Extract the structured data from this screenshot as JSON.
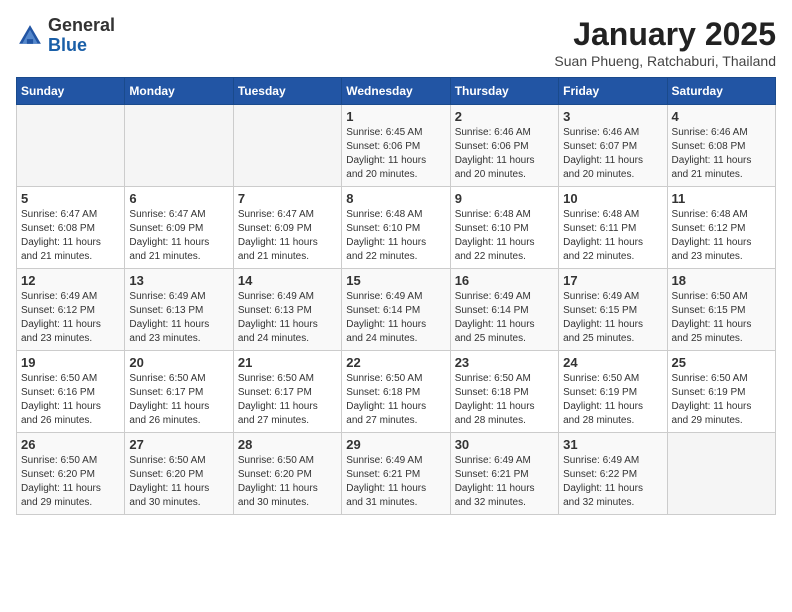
{
  "header": {
    "logo_general": "General",
    "logo_blue": "Blue",
    "month_title": "January 2025",
    "subtitle": "Suan Phueng, Ratchaburi, Thailand"
  },
  "weekdays": [
    "Sunday",
    "Monday",
    "Tuesday",
    "Wednesday",
    "Thursday",
    "Friday",
    "Saturday"
  ],
  "weeks": [
    [
      {
        "day": "",
        "info": ""
      },
      {
        "day": "",
        "info": ""
      },
      {
        "day": "",
        "info": ""
      },
      {
        "day": "1",
        "info": "Sunrise: 6:45 AM\nSunset: 6:06 PM\nDaylight: 11 hours\nand 20 minutes."
      },
      {
        "day": "2",
        "info": "Sunrise: 6:46 AM\nSunset: 6:06 PM\nDaylight: 11 hours\nand 20 minutes."
      },
      {
        "day": "3",
        "info": "Sunrise: 6:46 AM\nSunset: 6:07 PM\nDaylight: 11 hours\nand 20 minutes."
      },
      {
        "day": "4",
        "info": "Sunrise: 6:46 AM\nSunset: 6:08 PM\nDaylight: 11 hours\nand 21 minutes."
      }
    ],
    [
      {
        "day": "5",
        "info": "Sunrise: 6:47 AM\nSunset: 6:08 PM\nDaylight: 11 hours\nand 21 minutes."
      },
      {
        "day": "6",
        "info": "Sunrise: 6:47 AM\nSunset: 6:09 PM\nDaylight: 11 hours\nand 21 minutes."
      },
      {
        "day": "7",
        "info": "Sunrise: 6:47 AM\nSunset: 6:09 PM\nDaylight: 11 hours\nand 21 minutes."
      },
      {
        "day": "8",
        "info": "Sunrise: 6:48 AM\nSunset: 6:10 PM\nDaylight: 11 hours\nand 22 minutes."
      },
      {
        "day": "9",
        "info": "Sunrise: 6:48 AM\nSunset: 6:10 PM\nDaylight: 11 hours\nand 22 minutes."
      },
      {
        "day": "10",
        "info": "Sunrise: 6:48 AM\nSunset: 6:11 PM\nDaylight: 11 hours\nand 22 minutes."
      },
      {
        "day": "11",
        "info": "Sunrise: 6:48 AM\nSunset: 6:12 PM\nDaylight: 11 hours\nand 23 minutes."
      }
    ],
    [
      {
        "day": "12",
        "info": "Sunrise: 6:49 AM\nSunset: 6:12 PM\nDaylight: 11 hours\nand 23 minutes."
      },
      {
        "day": "13",
        "info": "Sunrise: 6:49 AM\nSunset: 6:13 PM\nDaylight: 11 hours\nand 23 minutes."
      },
      {
        "day": "14",
        "info": "Sunrise: 6:49 AM\nSunset: 6:13 PM\nDaylight: 11 hours\nand 24 minutes."
      },
      {
        "day": "15",
        "info": "Sunrise: 6:49 AM\nSunset: 6:14 PM\nDaylight: 11 hours\nand 24 minutes."
      },
      {
        "day": "16",
        "info": "Sunrise: 6:49 AM\nSunset: 6:14 PM\nDaylight: 11 hours\nand 25 minutes."
      },
      {
        "day": "17",
        "info": "Sunrise: 6:49 AM\nSunset: 6:15 PM\nDaylight: 11 hours\nand 25 minutes."
      },
      {
        "day": "18",
        "info": "Sunrise: 6:50 AM\nSunset: 6:15 PM\nDaylight: 11 hours\nand 25 minutes."
      }
    ],
    [
      {
        "day": "19",
        "info": "Sunrise: 6:50 AM\nSunset: 6:16 PM\nDaylight: 11 hours\nand 26 minutes."
      },
      {
        "day": "20",
        "info": "Sunrise: 6:50 AM\nSunset: 6:17 PM\nDaylight: 11 hours\nand 26 minutes."
      },
      {
        "day": "21",
        "info": "Sunrise: 6:50 AM\nSunset: 6:17 PM\nDaylight: 11 hours\nand 27 minutes."
      },
      {
        "day": "22",
        "info": "Sunrise: 6:50 AM\nSunset: 6:18 PM\nDaylight: 11 hours\nand 27 minutes."
      },
      {
        "day": "23",
        "info": "Sunrise: 6:50 AM\nSunset: 6:18 PM\nDaylight: 11 hours\nand 28 minutes."
      },
      {
        "day": "24",
        "info": "Sunrise: 6:50 AM\nSunset: 6:19 PM\nDaylight: 11 hours\nand 28 minutes."
      },
      {
        "day": "25",
        "info": "Sunrise: 6:50 AM\nSunset: 6:19 PM\nDaylight: 11 hours\nand 29 minutes."
      }
    ],
    [
      {
        "day": "26",
        "info": "Sunrise: 6:50 AM\nSunset: 6:20 PM\nDaylight: 11 hours\nand 29 minutes."
      },
      {
        "day": "27",
        "info": "Sunrise: 6:50 AM\nSunset: 6:20 PM\nDaylight: 11 hours\nand 30 minutes."
      },
      {
        "day": "28",
        "info": "Sunrise: 6:50 AM\nSunset: 6:20 PM\nDaylight: 11 hours\nand 30 minutes."
      },
      {
        "day": "29",
        "info": "Sunrise: 6:49 AM\nSunset: 6:21 PM\nDaylight: 11 hours\nand 31 minutes."
      },
      {
        "day": "30",
        "info": "Sunrise: 6:49 AM\nSunset: 6:21 PM\nDaylight: 11 hours\nand 32 minutes."
      },
      {
        "day": "31",
        "info": "Sunrise: 6:49 AM\nSunset: 6:22 PM\nDaylight: 11 hours\nand 32 minutes."
      },
      {
        "day": "",
        "info": ""
      }
    ]
  ]
}
